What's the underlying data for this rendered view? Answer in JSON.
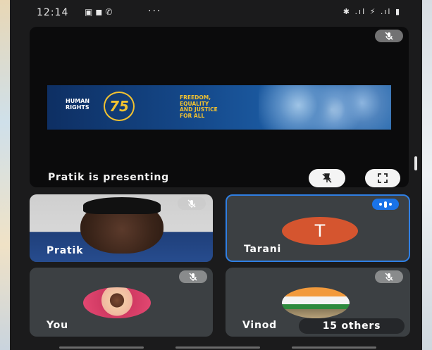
{
  "status_bar": {
    "time": "12:14",
    "left_icons": [
      "image-icon",
      "facebook-icon",
      "call-icon"
    ],
    "more": "···",
    "right_text": "✱ .ıl ⚡ .ıl ▮"
  },
  "presentation": {
    "label": "Pratik is presenting",
    "banner": {
      "left_text": "HUMAN\nRIGHTS",
      "number": "75",
      "right_text": "FREEDOM,\nEQUALITY\nAND JUSTICE\nFOR ALL"
    }
  },
  "participants": [
    {
      "name": "Pratik",
      "muted": true
    },
    {
      "name": "Tarani",
      "initial": "T",
      "speaking": true
    },
    {
      "name": "You",
      "muted": true
    },
    {
      "name": "Vinod",
      "muted": true,
      "others_label": "15 others"
    }
  ],
  "colors": {
    "tile": "#3c4043",
    "accent": "#1a73e8",
    "avatar_tarani": "#d5552f"
  }
}
